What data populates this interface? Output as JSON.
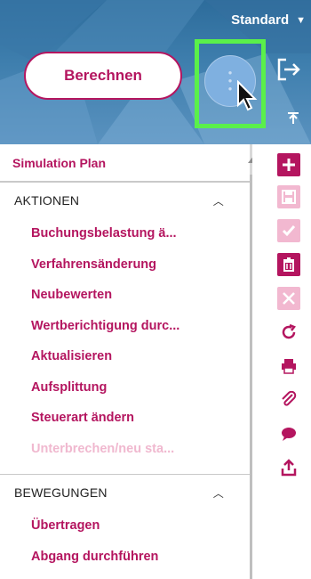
{
  "header": {
    "variant_label": "Standard",
    "calculate_label": "Berechnen"
  },
  "nav": {
    "title": "Simulation Plan",
    "sections": [
      {
        "heading": "AKTIONEN",
        "items": [
          {
            "label": "Buchungsbelastung ä...",
            "enabled": true
          },
          {
            "label": "Verfahrensänderung",
            "enabled": true
          },
          {
            "label": "Neubewerten",
            "enabled": true
          },
          {
            "label": "Wertberichtigung durc...",
            "enabled": true
          },
          {
            "label": "Aktualisieren",
            "enabled": true
          },
          {
            "label": "Aufsplittung",
            "enabled": true
          },
          {
            "label": "Steuerart ändern",
            "enabled": true
          },
          {
            "label": "Unterbrechen/neu sta...",
            "enabled": false
          }
        ]
      },
      {
        "heading": "BEWEGUNGEN",
        "items": [
          {
            "label": "Übertragen",
            "enabled": true
          },
          {
            "label": "Abgang durchführen",
            "enabled": true
          }
        ]
      }
    ]
  },
  "toolbar": {
    "icons": [
      "add-icon",
      "save-icon",
      "check-icon",
      "delete-icon",
      "cancel-icon",
      "refresh-icon",
      "print-icon",
      "attach-icon",
      "comment-icon",
      "share-icon"
    ]
  },
  "colors": {
    "accent": "#b4155f",
    "accent_disabled": "#f2b8d0",
    "header_blue": "#3f7fae",
    "highlight_green": "#5af04a"
  }
}
